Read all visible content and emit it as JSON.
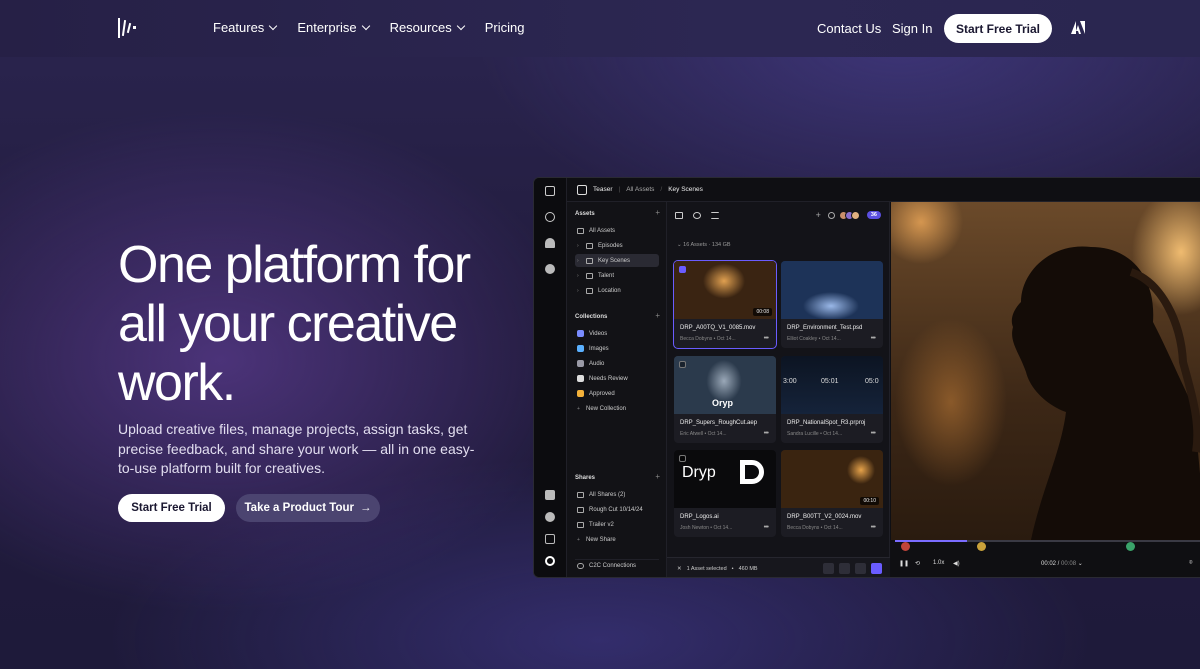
{
  "nav": {
    "links": [
      {
        "label": "Features",
        "dropdown": true
      },
      {
        "label": "Enterprise",
        "dropdown": true
      },
      {
        "label": "Resources",
        "dropdown": true
      },
      {
        "label": "Pricing",
        "dropdown": false
      }
    ],
    "contact": "Contact Us",
    "signin": "Sign In",
    "cta": "Start Free Trial"
  },
  "hero": {
    "title": "One platform for all your creative work.",
    "subtitle": "Upload creative files, manage projects, assign tasks, get precise feedback, and share your work — all in one easy-to-use platform built for creatives.",
    "primary_cta": "Start Free Trial",
    "secondary_cta": "Take a Product Tour",
    "secondary_arrow": "→"
  },
  "app": {
    "breadcrumb": [
      "Teaser",
      "All Assets",
      "Key Scenes"
    ],
    "sidebar": {
      "assets_heading": "Assets",
      "assets": [
        "All Assets",
        "Episodes",
        "Key Scenes",
        "Talent",
        "Location"
      ],
      "collections_heading": "Collections",
      "collections": [
        "Videos",
        "Images",
        "Audio",
        "Needs Review",
        "Approved",
        "New Collection"
      ],
      "shares_heading": "Shares",
      "shares": [
        "All Shares (2)",
        "Rough Cut 10/14/24",
        "Trailer v2",
        "New Share"
      ],
      "footer": "C2C Connections"
    },
    "grid": {
      "count": "16 Assets",
      "size": "134 GB",
      "badge": "36",
      "cards": [
        {
          "name": "DRP_A00TQ_V1_0085.mov",
          "author": "Becca Dobyns",
          "date": "Oct 14...",
          "duration": "00:08",
          "selected": true
        },
        {
          "name": "DRP_Environment_Test.psd",
          "author": "Elliot Coakley",
          "date": "Oct 14...",
          "duration": "",
          "selected": false
        },
        {
          "name": "DRP_Supers_RoughCut.aep",
          "author": "Eric Atwell",
          "date": "Oct 14...",
          "duration": "",
          "selected": false
        },
        {
          "name": "DRP_NationalSpot_R3.prproj",
          "author": "Sandra Lucille",
          "date": "Oct 14...",
          "duration": "",
          "selected": false
        },
        {
          "name": "DRP_Logos.ai",
          "author": "Josh Newton",
          "date": "Oct 14...",
          "duration": "",
          "selected": false
        },
        {
          "name": "DRP_B00TT_V2_0024.mov",
          "author": "Becca Dobyns",
          "date": "Oct 14...",
          "duration": "00:10",
          "selected": false
        }
      ],
      "thumb_text_1": "Oryp",
      "thumb_text_2": "Dryp",
      "timecodes": [
        "3:00",
        "05:01",
        "05:0"
      ],
      "selection": "1 Asset selected",
      "selection_size": "460 MB"
    },
    "viewer": {
      "speed": "1.0x",
      "time_current": "00:02",
      "time_total": "00:08",
      "progress": 0.23
    }
  }
}
